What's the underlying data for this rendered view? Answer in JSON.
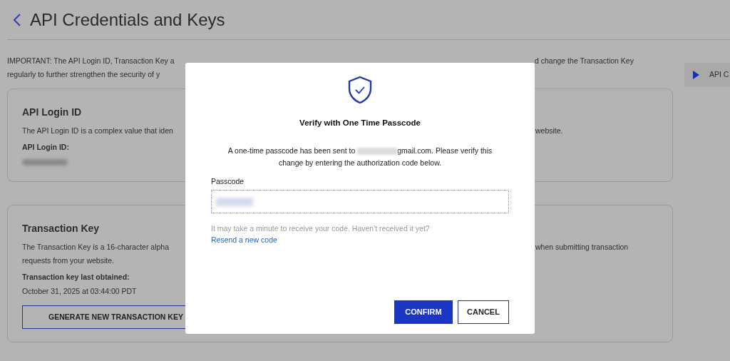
{
  "page": {
    "title": "API Credentials and Keys",
    "notice": [
      {
        "left": "IMPORTANT: The API Login ID, Transaction Key a",
        "right": "d change the Transaction Key"
      },
      {
        "left": "regularly to further strengthen the security of y"
      }
    ]
  },
  "side_tab": {
    "label": "API C"
  },
  "cards": [
    {
      "title": "API Login ID",
      "description": [
        {
          "left": "The API Login ID is a complex value that iden",
          "right": "website."
        }
      ],
      "field_label": "API Login ID:",
      "value_hidden": true
    },
    {
      "title": "Transaction Key",
      "description": [
        {
          "left": "The Transaction Key is a 16-character alpha",
          "right": "when submitting transaction"
        },
        {
          "left": "requests from your website."
        }
      ],
      "field_label": "Transaction key last obtained:",
      "field_value": "October 31, 2025 at 03:44:00 PDT",
      "button": "GENERATE NEW TRANSACTION KEY"
    }
  ],
  "dialog": {
    "title": "Verify with One Time Passcode",
    "message_before": "A one-time passcode has been sent to ",
    "email_hidden": true,
    "message_after": "gmail.com. Please verify this change by entering the authorization code below.",
    "field_label": "Passcode",
    "value_hidden": true,
    "hint": "It may take a minute to receive your code. Haven't received it yet?",
    "link": "Resend a new code",
    "buttons": [
      {
        "label": "CONFIRM",
        "kind": "primary"
      },
      {
        "label": "CANCEL",
        "kind": "secondary"
      }
    ]
  }
}
